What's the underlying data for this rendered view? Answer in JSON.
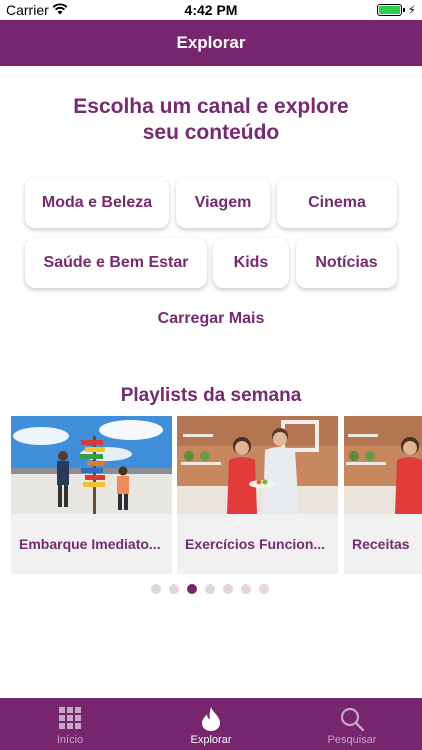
{
  "status_bar": {
    "carrier": "Carrier",
    "time": "4:42 PM",
    "battery_level": 1.0
  },
  "nav": {
    "title": "Explorar"
  },
  "heading": {
    "line1": "Escolha um canal e explore",
    "line2": "seu conteúdo"
  },
  "channels": [
    {
      "label": "Moda e Beleza"
    },
    {
      "label": "Viagem"
    },
    {
      "label": "Cinema"
    },
    {
      "label": "Saúde e Bem Estar"
    },
    {
      "label": "Kids"
    },
    {
      "label": "Notícias"
    }
  ],
  "load_more_label": "Carregar Mais",
  "playlists": {
    "title": "Playlists da semana",
    "items": [
      {
        "title": "Embarque Imediato..."
      },
      {
        "title": "Exercícios Funcion..."
      },
      {
        "title": "Receitas"
      }
    ],
    "page_count": 7,
    "active_page": 3
  },
  "tabs": [
    {
      "label": "Início",
      "icon": "grid-icon"
    },
    {
      "label": "Explorar",
      "icon": "flame-icon",
      "active": true
    },
    {
      "label": "Pesquisar",
      "icon": "search-icon"
    }
  ],
  "colors": {
    "brand": "#76256e",
    "accent_text": "#762a6f",
    "tab_inactive": "#c7a9c3",
    "dot_inactive": "#e2d4e0",
    "battery": "#2bd14a"
  }
}
